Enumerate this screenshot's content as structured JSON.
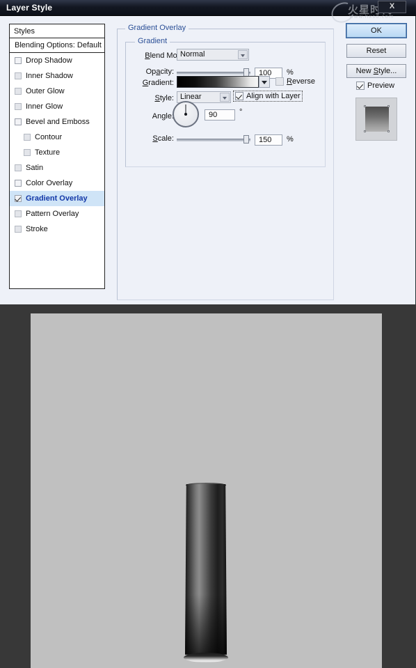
{
  "window": {
    "title": "Layer Style",
    "close_label": "X",
    "watermark_text": "火星时代",
    "watermark_url": "www.hxsd.com"
  },
  "styles_panel": {
    "header": "Styles",
    "blending_options": "Blending Options: Default",
    "items": [
      {
        "label": "Drop Shadow",
        "checked": false,
        "indent": false,
        "dim": false,
        "selected": false
      },
      {
        "label": "Inner Shadow",
        "checked": false,
        "indent": false,
        "dim": true,
        "selected": false
      },
      {
        "label": "Outer Glow",
        "checked": false,
        "indent": false,
        "dim": true,
        "selected": false
      },
      {
        "label": "Inner Glow",
        "checked": false,
        "indent": false,
        "dim": true,
        "selected": false
      },
      {
        "label": "Bevel and Emboss",
        "checked": false,
        "indent": false,
        "dim": false,
        "selected": false
      },
      {
        "label": "Contour",
        "checked": false,
        "indent": true,
        "dim": true,
        "selected": false
      },
      {
        "label": "Texture",
        "checked": false,
        "indent": true,
        "dim": true,
        "selected": false
      },
      {
        "label": "Satin",
        "checked": false,
        "indent": false,
        "dim": true,
        "selected": false
      },
      {
        "label": "Color Overlay",
        "checked": false,
        "indent": false,
        "dim": false,
        "selected": false
      },
      {
        "label": "Gradient Overlay",
        "checked": true,
        "indent": false,
        "dim": false,
        "selected": true
      },
      {
        "label": "Pattern Overlay",
        "checked": false,
        "indent": false,
        "dim": true,
        "selected": false
      },
      {
        "label": "Stroke",
        "checked": false,
        "indent": false,
        "dim": true,
        "selected": false
      }
    ]
  },
  "main": {
    "section_title": "Gradient Overlay",
    "group_title": "Gradient",
    "blend_mode": {
      "label_a": "B",
      "label_b": "lend Mode:",
      "value": "Normal"
    },
    "opacity": {
      "label_a": "Op",
      "label_b": "a",
      "label_c": "city:",
      "value": "100",
      "unit": "%"
    },
    "gradient": {
      "label_a": "G",
      "label_b": "radient:",
      "reverse_label_a": "R",
      "reverse_label_b": "everse",
      "reverse_checked": false
    },
    "style": {
      "label_a": "S",
      "label_b": "tyle:",
      "value": "Linear",
      "align_label": "Align with Layer",
      "align_checked": true
    },
    "angle": {
      "label_a": "An",
      "label_b": "g",
      "label_c": "le:",
      "value": "90",
      "unit": "°"
    },
    "scale": {
      "label_a": "S",
      "label_b": "cale:",
      "value": "150",
      "unit": "%"
    }
  },
  "buttons": {
    "ok": "OK",
    "reset": "Reset",
    "new_style_a": "New ",
    "new_style_b": "S",
    "new_style_c": "tyle...",
    "preview_label": "Preview",
    "preview_checked": true
  },
  "colors": {
    "title_bar": "#131722",
    "dialog_bg": "#eef1f8",
    "accent_blue": "#2b4f96",
    "selection": "#cfe4f7",
    "selected_text": "#1338a8",
    "canvas_bg": "#c0c0c0",
    "desktop_bg": "#383838"
  }
}
